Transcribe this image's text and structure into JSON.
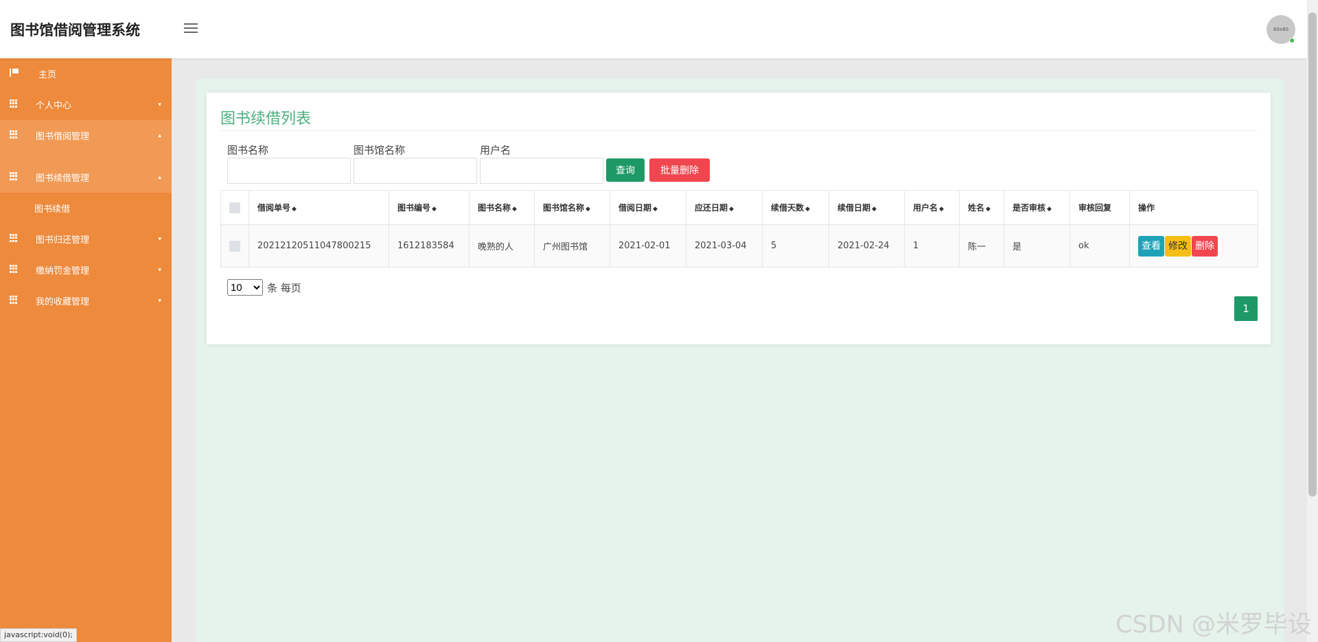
{
  "header": {
    "app_title": "图书馆借阅管理系统",
    "avatar_text": "60x60"
  },
  "sidebar": {
    "home": "主页",
    "items": [
      {
        "label": "个人中心",
        "caret": "▾"
      },
      {
        "label": "图书借阅管理",
        "caret": "▴"
      },
      {
        "label": "图书续借管理",
        "caret": "▴"
      },
      {
        "label": "图书归还管理",
        "caret": "▾"
      },
      {
        "label": "缴纳罚金管理",
        "caret": "▾"
      },
      {
        "label": "我的收藏管理",
        "caret": "▾"
      }
    ],
    "sub_item": "图书续借"
  },
  "status_url": "javascript:void(0);",
  "page": {
    "title": "图书续借列表",
    "filters": {
      "book_name_label": "图书名称",
      "library_name_label": "图书馆名称",
      "username_label": "用户名",
      "search_button": "查询",
      "batch_delete_button": "批量删除"
    },
    "table": {
      "columns": [
        "借阅单号",
        "图书编号",
        "图书名称",
        "图书馆名称",
        "借阅日期",
        "应还日期",
        "续借天数",
        "续借日期",
        "用户名",
        "姓名",
        "是否审核",
        "审核回复",
        "操作"
      ],
      "rows": [
        [
          "20212120511047800215",
          "1612183584",
          "晚熟的人",
          "广州图书馆",
          "2021-02-01",
          "2021-03-04",
          "5",
          "2021-02-24",
          "1",
          "陈一",
          "是",
          "ok"
        ]
      ],
      "actions": {
        "view": "查看",
        "edit": "修改",
        "delete": "删除"
      }
    },
    "pagination": {
      "page_size": "10",
      "page_size_suffix": "条 每页",
      "current_page": "1"
    }
  },
  "watermark": "CSDN @米罗毕设"
}
